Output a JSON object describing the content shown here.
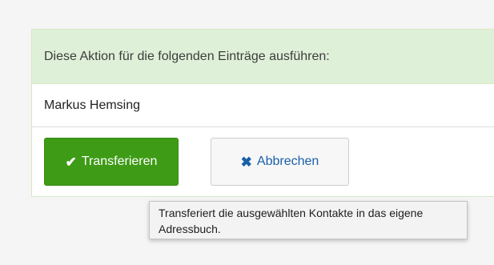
{
  "panel": {
    "heading": "Diese Aktion für die folgenden Einträge ausführen:",
    "items": [
      {
        "name": "Markus Hemsing"
      }
    ]
  },
  "buttons": {
    "transfer": {
      "label": "Transferieren",
      "icon": "checkmark-icon"
    },
    "cancel": {
      "label": "Abbrechen",
      "icon": "close-icon"
    }
  },
  "tooltip": {
    "text": "Transferiert die ausgewählten Kontakte in das eigene Adressbuch."
  },
  "colors": {
    "success": "#3e9b16",
    "panel_heading_bg": "#dff0d8",
    "link_blue": "#1a5fa8"
  }
}
